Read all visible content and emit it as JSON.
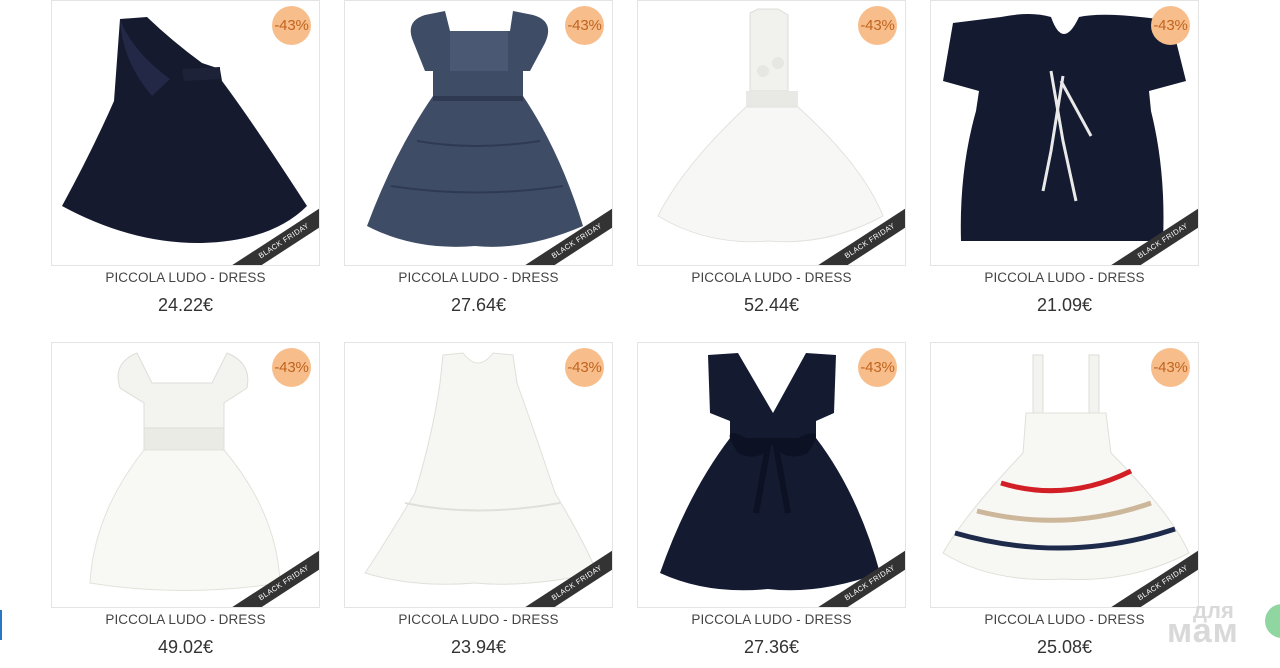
{
  "products": [
    {
      "title": "PICCOLA LUDO - DRESS",
      "price": "24.22€",
      "discount": "-43%",
      "ribbon": "BLACK FRIDAY"
    },
    {
      "title": "PICCOLA LUDO - DRESS",
      "price": "27.64€",
      "discount": "-43%",
      "ribbon": "BLACK FRIDAY"
    },
    {
      "title": "PICCOLA LUDO - DRESS",
      "price": "52.44€",
      "discount": "-43%",
      "ribbon": "BLACK FRIDAY"
    },
    {
      "title": "PICCOLA LUDO - DRESS",
      "price": "21.09€",
      "discount": "-43%",
      "ribbon": "BLACK FRIDAY"
    },
    {
      "title": "PICCOLA LUDO - DRESS",
      "price": "49.02€",
      "discount": "-43%",
      "ribbon": "BLACK FRIDAY"
    },
    {
      "title": "PICCOLA LUDO - DRESS",
      "price": "23.94€",
      "discount": "-43%",
      "ribbon": "BLACK FRIDAY"
    },
    {
      "title": "PICCOLA LUDO - DRESS",
      "price": "27.36€",
      "discount": "-43%",
      "ribbon": "BLACK FRIDAY"
    },
    {
      "title": "PICCOLA LUDO - DRESS",
      "price": "25.08€",
      "discount": "-43%",
      "ribbon": "BLACK FRIDAY"
    }
  ],
  "watermark": {
    "line1": "для",
    "line2": "мам"
  },
  "colors": {
    "badge_bg": "#f7be8c",
    "badge_text": "#c0641f",
    "ribbon_bg": "#333333",
    "navy": "#141a30",
    "denim": "#3f4c66",
    "white_dress": "#f4f4f2"
  }
}
